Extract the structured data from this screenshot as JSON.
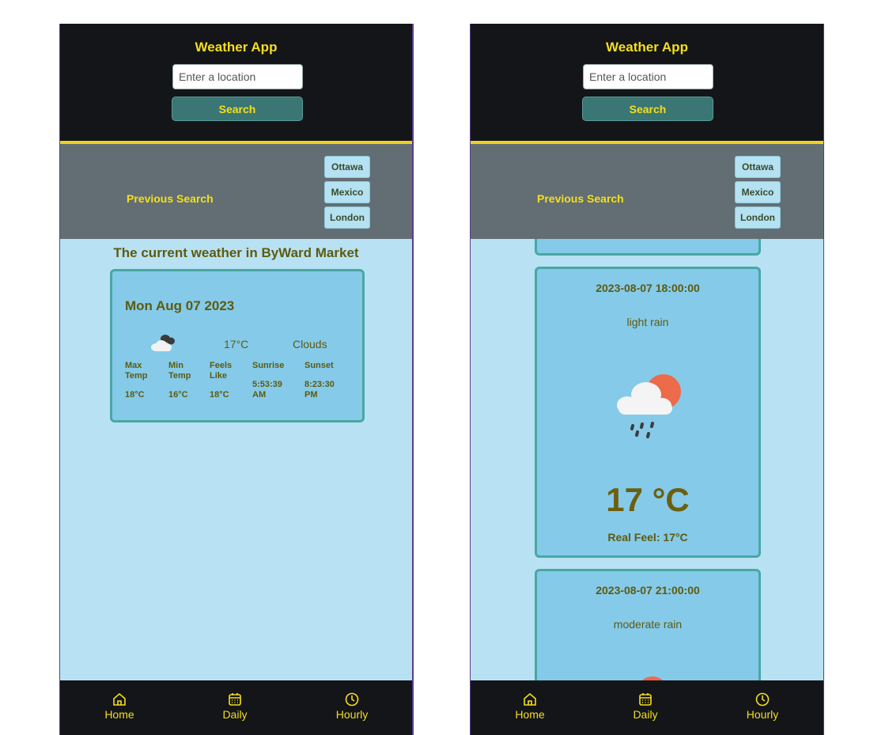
{
  "app": {
    "title": "Weather App"
  },
  "search": {
    "placeholder": "Enter a location",
    "button_label": "Search"
  },
  "previous": {
    "label": "Previous Search",
    "cities": [
      "Ottawa",
      "Mexico",
      "London"
    ]
  },
  "nav": [
    {
      "label": "Home",
      "icon": "home-icon"
    },
    {
      "label": "Daily",
      "icon": "calendar-icon"
    },
    {
      "label": "Hourly",
      "icon": "clock-icon"
    }
  ],
  "current": {
    "title": "The current weather in ByWard Market",
    "date": "Mon Aug 07 2023",
    "temp": "17°C",
    "description": "Clouds",
    "icon": "clouds-icon",
    "stats": [
      {
        "label": "Max Temp",
        "value": "18°C"
      },
      {
        "label": "Min Temp",
        "value": "16°C"
      },
      {
        "label": "Feels Like",
        "value": "18°C"
      },
      {
        "label": "Sunrise",
        "value": "5:53:39 AM"
      },
      {
        "label": "Sunset",
        "value": "8:23:30 PM"
      }
    ]
  },
  "hourly": [
    {
      "time": "2023-08-07 18:00:00",
      "description": "light rain",
      "icon": "rain-sun-icon",
      "temp": "17 °C",
      "real_feel": "Real Feel: 17°C"
    },
    {
      "time": "2023-08-07 21:00:00",
      "description": "moderate rain",
      "icon": "rain-sun-icon"
    }
  ],
  "colors": {
    "accent": "#f6df1c",
    "header_bg": "#131519",
    "page_bg": "#b8e2f3",
    "card_bg": "#85cae9",
    "card_border": "#48a7a4",
    "button_bg": "#397674",
    "text_olive": "#5e5b0e"
  }
}
